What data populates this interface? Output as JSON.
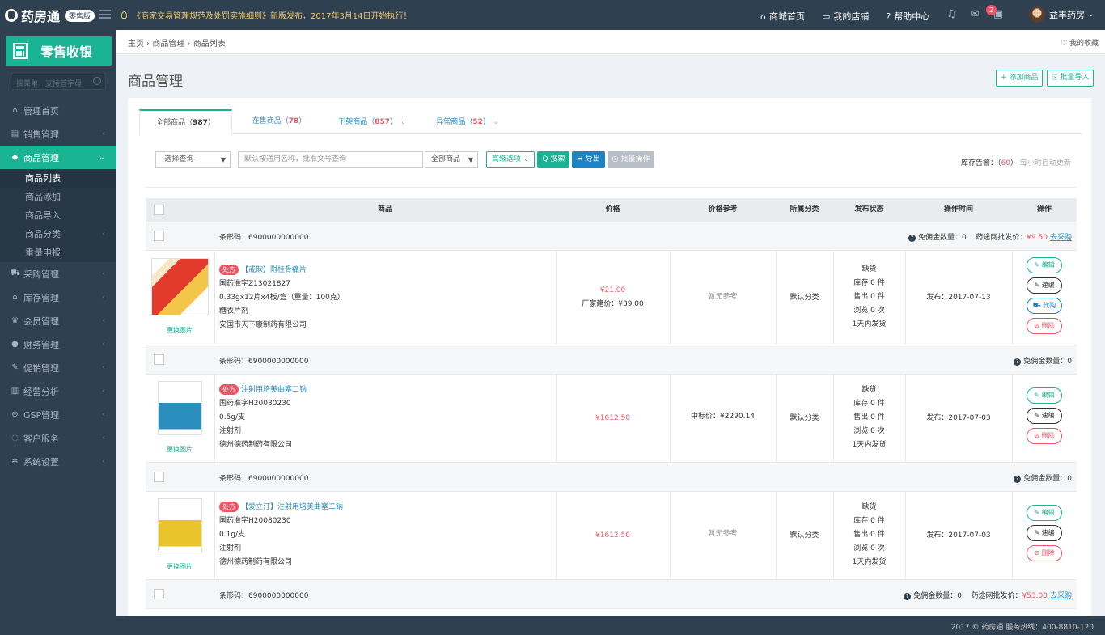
{
  "app": {
    "name": "药房通",
    "badge": "零售版"
  },
  "notice": "《商家交易管理规范及处罚实施细则》新版发布，2017年3月14日开始执行！",
  "topnav": [
    {
      "icon": "⌂",
      "label": "商城首页"
    },
    {
      "icon": "▭",
      "label": "我的店铺"
    },
    {
      "icon": "?",
      "label": "帮助中心"
    }
  ],
  "top_icons": {
    "msg_count": "2"
  },
  "user": {
    "name": "益丰药房"
  },
  "sidebar": {
    "brand": "零售收银",
    "search_placeholder": "搜菜单，支持首字母",
    "menu": [
      {
        "icon": "⌂",
        "label": "管理首页"
      },
      {
        "icon": "▤",
        "label": "销售管理"
      },
      {
        "icon": "◆",
        "label": "商品管理"
      },
      {
        "icon": "⛟",
        "label": "采购管理"
      },
      {
        "icon": "⌂",
        "label": "库存管理"
      },
      {
        "icon": "♛",
        "label": "会员管理"
      },
      {
        "icon": "●",
        "label": "财务管理"
      },
      {
        "icon": "✎",
        "label": "促销管理"
      },
      {
        "icon": "▥",
        "label": "经营分析"
      },
      {
        "icon": "⊕",
        "label": "GSP管理"
      },
      {
        "icon": "◌",
        "label": "客户服务"
      },
      {
        "icon": "✲",
        "label": "系统设置"
      }
    ],
    "submenu": [
      "商品列表",
      "商品添加",
      "商品导入",
      "商品分类",
      "重量申报"
    ]
  },
  "breadcrumb": "主页 › 商品管理 › 商品列表",
  "favorite": "♡ 我的收藏",
  "page_title": "商品管理",
  "header_buttons": {
    "add": "+ 添加商品",
    "import": "⎘ 批量导入"
  },
  "tabs": [
    {
      "label": "全部商品（",
      "count": "987",
      "tail": "）"
    },
    {
      "label": "在售商品（",
      "count": "78",
      "tail": "）"
    },
    {
      "label": "下架商品（",
      "count": "857",
      "tail": "）"
    },
    {
      "label": "异常商品（",
      "count": "52",
      "tail": "）"
    }
  ],
  "filters": {
    "select_query": "-选择查询-",
    "search_placeholder": "默认按通用名称，批准文号查询",
    "scope": "全部商品",
    "advanced": "高级选项 ⌄",
    "search": "Q 搜索",
    "export": "➦ 导出",
    "batch": "◎ 批量操作"
  },
  "stock_warning": {
    "label": "库存告警：（",
    "count": "60",
    "close": "）",
    "tip": "每小时自动更新"
  },
  "table": {
    "headers": [
      "商品",
      "价格",
      "价格参考",
      "所属分类",
      "发布状态",
      "操作时间",
      "操作"
    ],
    "rows": [
      {
        "barcode": "条形码：6900000000000",
        "bar_right": {
          "free": "免佣金数量：0",
          "wholesale_label": "药途网批发价：",
          "wholesale": "¥9.50",
          "buy": "去采购"
        },
        "rx": "处方",
        "name": "【戒欺】附桂骨痛片",
        "approval": "国药准字Z13021827",
        "spec": "0.33gx12片x4板/盒（重量：100克）",
        "form": "糖衣片剂",
        "maker": "安国市天下康制药有限公司",
        "price": "¥21.00",
        "price2": "厂家建价：¥39.00",
        "ref": "暂无参考",
        "category": "默认分类",
        "status": [
          "缺货",
          "库存 0 件",
          "售出 0 件",
          "浏览 0 次",
          "1天内发货"
        ],
        "time": "发布：2017-07-13",
        "ops": [
          "✎ 编辑",
          "✎ 速编",
          "⛟ 代购",
          "⊘ 删除"
        ],
        "change_img": "更换图片"
      },
      {
        "barcode": "条形码：6900000000000",
        "bar_right": {
          "free": "免佣金数量：0"
        },
        "rx": "处方",
        "name": "注射用培美曲塞二钠",
        "approval": "国药准字H20080230",
        "spec": "0.5g/支",
        "form": "注射剂",
        "maker": "德州德药制药有限公司",
        "price": "¥1612.50",
        "ref": "中标价：¥2290.14",
        "category": "默认分类",
        "status": [
          "缺货",
          "库存 0 件",
          "售出 0 件",
          "浏览 0 次",
          "1天内发货"
        ],
        "time": "发布：2017-07-03",
        "ops": [
          "✎ 编辑",
          "✎ 速编",
          "⊘ 删除"
        ],
        "change_img": "更换图片"
      },
      {
        "barcode": "条形码：6900000000000",
        "bar_right": {
          "free": "免佣金数量：0"
        },
        "rx": "处方",
        "name": "【爱立汀】注射用培美曲塞二钠",
        "approval": "国药准字H20080230",
        "spec": "0.1g/支",
        "form": "注射剂",
        "maker": "德州德药制药有限公司",
        "price": "¥1612.50",
        "ref": "暂无参考",
        "category": "默认分类",
        "status": [
          "缺货",
          "库存 0 件",
          "售出 0 件",
          "浏览 0 次",
          "1天内发货"
        ],
        "time": "发布：2017-07-03",
        "ops": [
          "✎ 编辑",
          "✎ 速编",
          "⊘ 删除"
        ],
        "change_img": "更换图片"
      },
      {
        "barcode": "条形码：6900000000000",
        "bar_right": {
          "free": "免佣金数量：0",
          "wholesale_label": "药途网批发价：",
          "wholesale": "¥53.00",
          "buy": "去采购"
        }
      }
    ]
  },
  "footer": "2017 © 药房通  服务热线：400-8810-120",
  "colors": {
    "sidebar": "#2f4050",
    "accent": "#1ab394",
    "blue": "#1c84c6",
    "danger": "#ed5565"
  }
}
